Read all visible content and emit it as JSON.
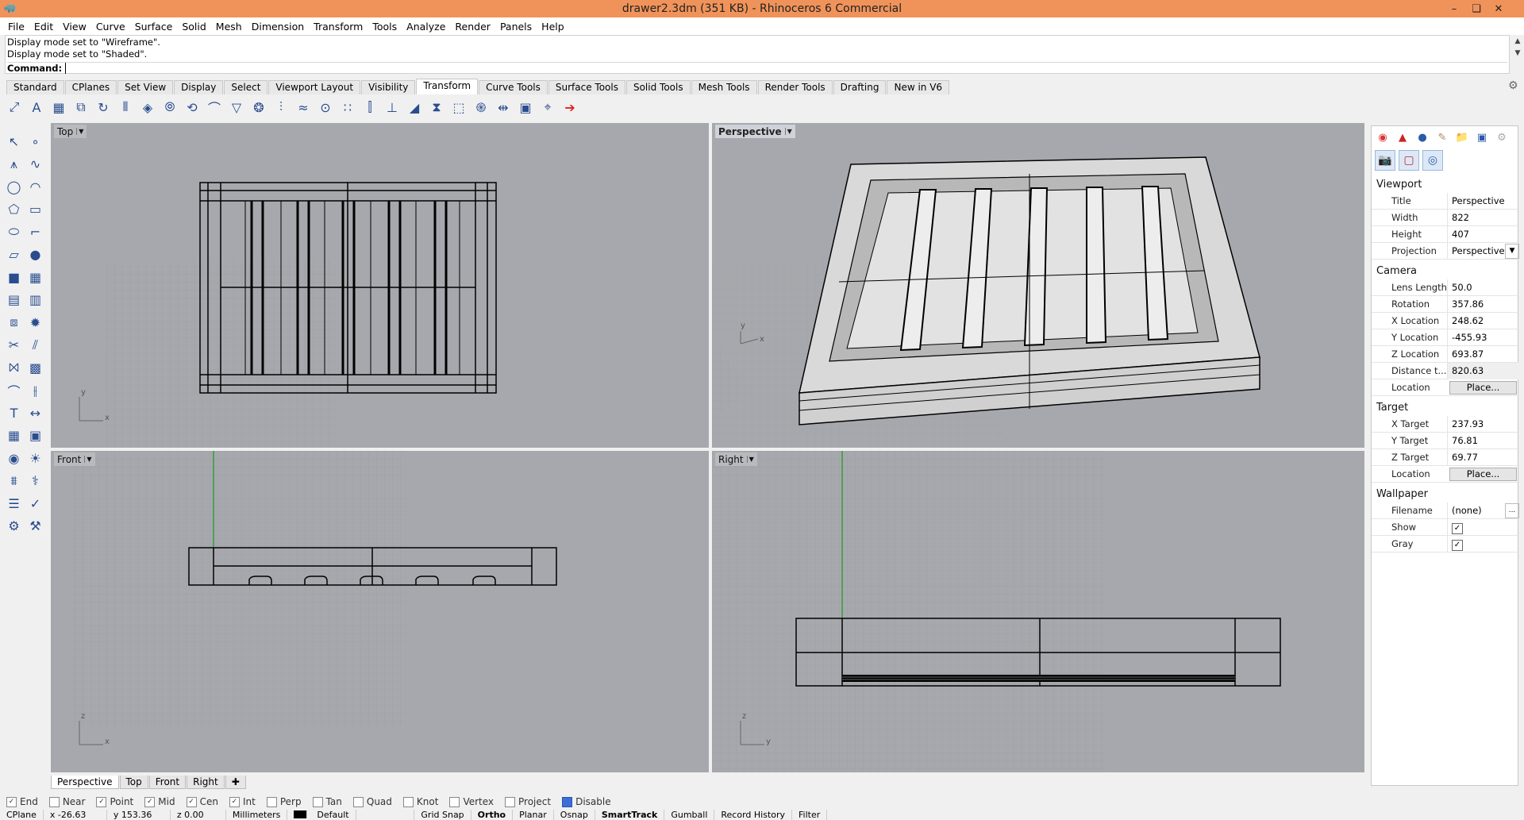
{
  "window": {
    "title": "drawer2.3dm (351 KB) - Rhinoceros 6 Commercial",
    "app_icon": "rhino-logo-icon",
    "controls": [
      "–",
      "❏",
      "✕"
    ]
  },
  "menu": [
    "File",
    "Edit",
    "View",
    "Curve",
    "Surface",
    "Solid",
    "Mesh",
    "Dimension",
    "Transform",
    "Tools",
    "Analyze",
    "Render",
    "Panels",
    "Help"
  ],
  "command": {
    "history": [
      "Display mode set to \"Wireframe\".",
      "Display mode set to \"Shaded\"."
    ],
    "prompt": "Command:"
  },
  "toolbar_tabs": [
    "Standard",
    "CPlanes",
    "Set View",
    "Display",
    "Select",
    "Viewport Layout",
    "Visibility",
    "Transform",
    "Curve Tools",
    "Surface Tools",
    "Solid Tools",
    "Mesh Tools",
    "Render Tools",
    "Drafting",
    "New in V6"
  ],
  "active_toolbar_tab": "Transform",
  "toolbar_icons": [
    "move-icon",
    "text-icon",
    "array-icon",
    "copy-icon",
    "rotate-icon",
    "mirror-icon",
    "scale-icon",
    "orient-icon",
    "twist-icon",
    "bend-icon",
    "taper-icon",
    "polar-array-icon",
    "array-curve-icon",
    "flow-icon",
    "splop-icon",
    "set-points-icon",
    "align-icon",
    "project-icon",
    "smash-icon",
    "squish-icon",
    "cage-icon",
    "maelstrom-icon",
    "stretch-icon",
    "box-edit-icon",
    "gumball-icon",
    "arrow-red-icon"
  ],
  "left_tools": [
    "select-icon",
    "point-icon",
    "polyline-icon",
    "curve-icon",
    "circle-icon",
    "arc-icon",
    "polygon-icon",
    "rectangle-icon",
    "ellipse-icon",
    "fillet-icon",
    "surface-icon",
    "sphere-icon",
    "solid-box-icon",
    "mesh-icon",
    "extrude-icon",
    "loft-icon",
    "boolean-icon",
    "explode-icon",
    "trim-icon",
    "split-icon",
    "join-icon",
    "group-icon",
    "curve-edit-icon",
    "offset-icon",
    "text-tool-icon",
    "dimension-icon",
    "array-tool-icon",
    "block-icon",
    "render-icon",
    "light-icon",
    "grid-icon",
    "analyze-icon",
    "layer-icon",
    "check-icon",
    "properties-icon",
    "options-icon"
  ],
  "viewports": {
    "top": "Top",
    "perspective": "Perspective",
    "front": "Front",
    "right": "Right"
  },
  "viewport_tabs": [
    "Perspective",
    "Top",
    "Front",
    "Right"
  ],
  "panel": {
    "tabs": [
      "color-icon",
      "layers-icon",
      "materials-icon",
      "lights-icon",
      "folder-icon",
      "display-icon",
      "gear-icon"
    ],
    "subtabs": [
      "camera-icon",
      "viewport-icon",
      "target-icon"
    ],
    "viewport_section": "Viewport",
    "viewport": [
      [
        "Title",
        "Perspective"
      ],
      [
        "Width",
        "822"
      ],
      [
        "Height",
        "407"
      ],
      [
        "Projection",
        "Perspective"
      ]
    ],
    "camera_section": "Camera",
    "camera": [
      [
        "Lens Length",
        "50.0"
      ],
      [
        "Rotation",
        "357.86"
      ],
      [
        "X Location",
        "248.62"
      ],
      [
        "Y Location",
        "-455.93"
      ],
      [
        "Z Location",
        "693.87"
      ],
      [
        "Distance t...",
        "820.63"
      ],
      [
        "Location",
        "Place..."
      ]
    ],
    "target_section": "Target",
    "target": [
      [
        "X Target",
        "237.93"
      ],
      [
        "Y Target",
        "76.81"
      ],
      [
        "Z Target",
        "69.77"
      ],
      [
        "Location",
        "Place..."
      ]
    ],
    "wallpaper_section": "Wallpaper",
    "wallpaper": [
      [
        "Filename",
        "(none)"
      ],
      [
        "Show",
        ""
      ],
      [
        "Gray",
        ""
      ]
    ]
  },
  "osnap": [
    {
      "label": "End",
      "on": true
    },
    {
      "label": "Near",
      "on": false
    },
    {
      "label": "Point",
      "on": true
    },
    {
      "label": "Mid",
      "on": true
    },
    {
      "label": "Cen",
      "on": true
    },
    {
      "label": "Int",
      "on": true
    },
    {
      "label": "Perp",
      "on": false
    },
    {
      "label": "Tan",
      "on": false
    },
    {
      "label": "Quad",
      "on": false
    },
    {
      "label": "Knot",
      "on": false
    },
    {
      "label": "Vertex",
      "on": false
    },
    {
      "label": "Project",
      "on": false
    },
    {
      "label": "Disable",
      "on": true
    }
  ],
  "status": [
    "CPlane",
    "x -26.63",
    "y 153.36",
    "z 0.00",
    "Millimeters",
    "Default",
    "Grid Snap",
    "Ortho",
    "Planar",
    "Osnap",
    "SmartTrack",
    "Gumball",
    "Record History",
    "Filter"
  ]
}
